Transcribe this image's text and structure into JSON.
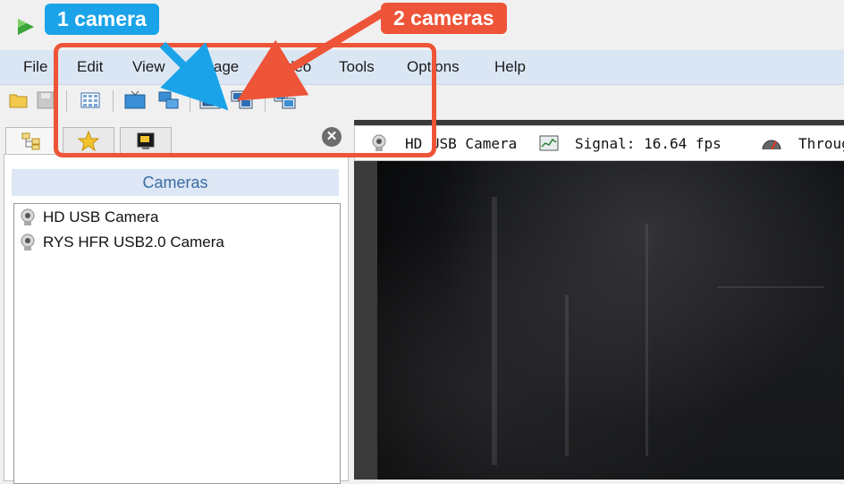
{
  "app": {
    "icon": "green-play-icon"
  },
  "menu": [
    "File",
    "Edit",
    "View",
    "Image",
    "Video",
    "Tools",
    "Options",
    "Help"
  ],
  "toolbar": {
    "icons": [
      "open-folder-icon",
      "save-disk-icon",
      "grid-view-icon",
      "monitor-icon",
      "multi-monitor-icon",
      "single-camera-icon",
      "dual-camera-icon",
      "camera-layout-icon"
    ]
  },
  "left_panel": {
    "tabs": [
      "tree-view-icon",
      "favorites-star-icon",
      "screen-capture-icon"
    ],
    "cameras_header": "Cameras",
    "cameras": [
      "HD USB Camera",
      "RYS HFR USB2.0 Camera"
    ]
  },
  "status": {
    "camera_name": "HD USB Camera",
    "signal_label": "Signal: 16.64 fps",
    "throughput_label": "Throug"
  },
  "annotations": {
    "one_camera": "1 camera",
    "two_cameras": "2 cameras",
    "colors": {
      "blue": "#1aa3e8",
      "red": "#ee5438"
    }
  }
}
